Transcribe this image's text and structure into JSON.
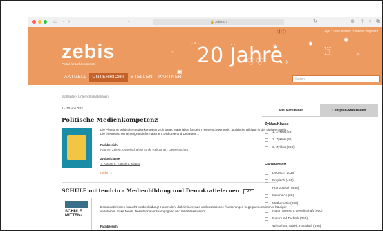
{
  "browser": {
    "url": "zebis.ch"
  },
  "header": {
    "top_links": "Login · Konto eröffnen · Passwort vergessen",
    "logo": "zebis",
    "logo_sub": "Portal für Lehrpersonen",
    "anniversary": "20 Jahre",
    "nav": [
      "AKTUELL",
      "UNTERRICHT",
      "STELLEN",
      "PARTNER"
    ],
    "search_placeholder": "Suchen"
  },
  "main": {
    "breadcrumb": "Startseite » Unterrichtsmaterialien",
    "result_count": "1 - 10 von 283",
    "items": [
      {
        "title": "Politische Medienkompetenz",
        "description": "Die Plattform politische-medienkompetenz.ch bietet Materialien für den Themenschwerpunkt „politische Bildung in der digitalen Welt“. Die theoretischen Hintergrundinformationen, Diskurse und Debatten ...",
        "label_fach": "Fachbereich",
        "fach": "Räume, Zeiten, Gesellschaften Ethik, Religionen, Gemeinschaft",
        "label_zyklus": "Zyklus/Klasse",
        "zyklus": "7. Klasse 8. Klasse 9. Klasse",
        "more": "mehr →"
      },
      {
        "title": "SCHULE mittendrin - Medienbildung und Demokratielernen",
        "badge": "LP21",
        "description": "Demokratielernen braucht Medienbildung! Hassreden, diskriminierende und rassistische Äusserungen begegnen uns immer häufiger im Internet. Fake News, Desinformationskampagnen und Filterblasen sind ...",
        "thumb_text": "SCHULE MITTEN-",
        "label_fach": "Fachbereich"
      }
    ]
  },
  "sidebar": {
    "tabs": [
      "Alle Materialien",
      "Lehrplan-Materialien"
    ],
    "zyklus_title": "Zyklus/Klasse",
    "zyklus": [
      "1. Zyklus (23)",
      "2. Zyklus (36)",
      "3. Zyklus (268)"
    ],
    "fach_title": "Fachbereich",
    "fach": [
      "Deutsch (1035)",
      "Englisch (401)",
      "Französisch (488)",
      "Italienisch (65)",
      "Mathematik (690)",
      "Natur, Mensch, Gesellschaft (900)",
      "Natur und Technik (355)",
      "Wirtschaft, Arbeit, Haushalt (198)"
    ]
  },
  "colors": {
    "header": "#ec9a5f",
    "nav_active": "#c4622a",
    "accent": "#e07a30",
    "tab_active": "#cfcfcf",
    "thumb1": "#1a8da6",
    "thumb2": "#3b6e88"
  }
}
